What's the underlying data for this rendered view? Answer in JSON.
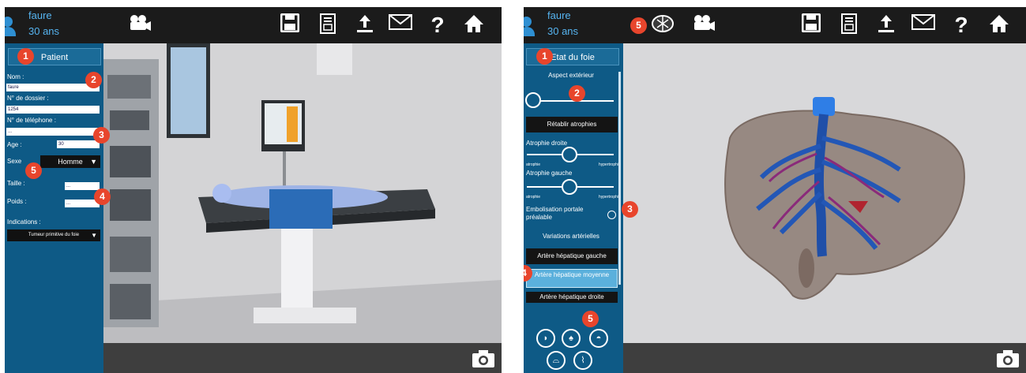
{
  "left": {
    "user": {
      "name": "faure",
      "age": "30 ans"
    },
    "panel": {
      "header": "Patient",
      "nom_label": "Nom :",
      "nom_value": "faure",
      "dossier_label": "N° de dossier :",
      "dossier_value": "1254",
      "telephone_label": "N° de téléphone :",
      "telephone_value": "...",
      "age_label": "Age :",
      "age_value": "30",
      "sexe_label": "Sexe",
      "sexe_value": "Homme",
      "taille_label": "Taille :",
      "taille_value": "...",
      "poids_label": "Poids :",
      "poids_value": "...",
      "indications_label": "Indications :",
      "indications_value": "Tumeur primitive du foie"
    },
    "badges": [
      "1",
      "2",
      "3",
      "4",
      "5"
    ]
  },
  "right": {
    "user": {
      "name": "faure",
      "age": "30 ans"
    },
    "panel": {
      "header": "Etat du foie",
      "aspect": "Aspect extérieur",
      "retablir": "Rétablir atrophies",
      "atrophie_droite": "Atrophie droite",
      "atrophie_gauche": "Atrophie gauche",
      "atrophie_min": "atrophie",
      "atrophie_max": "hypertrophie",
      "embolisation": "Embolisation portale préalable",
      "variations": "Variations artérielles",
      "artere_gauche": "Artère hépatique gauche",
      "artere_moyenne": "Artère hépatique moyenne",
      "artere_droite": "Artère hépatique droite"
    },
    "badges": [
      "1",
      "2",
      "3",
      "4",
      "5",
      "5"
    ]
  },
  "colors": {
    "panel": "#0e5a86",
    "accent": "#56b4f0",
    "badge": "#e8452c",
    "topbar": "#1b1b1b",
    "portal_vein": "#1f4fa8",
    "artery": "#8a2a7a"
  },
  "toolbar_icons": [
    "camera-icon",
    "save-icon",
    "report-icon",
    "upload-icon",
    "mail-icon",
    "help-icon",
    "home-icon"
  ],
  "organ_icons": [
    "stomach-icon",
    "lungs-icon",
    "liver-icon",
    "pelvis-icon",
    "vessel-icon"
  ]
}
